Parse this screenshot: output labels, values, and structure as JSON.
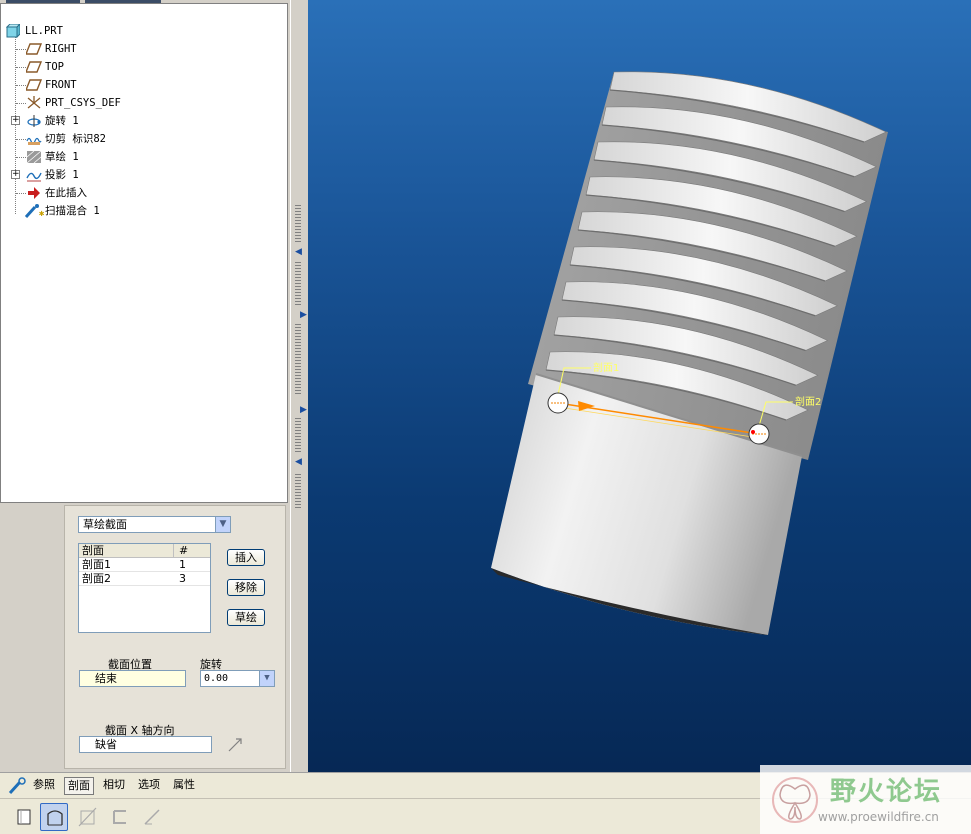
{
  "model_tree": {
    "items": [
      {
        "label": "LL.PRT",
        "icon": "part-icon"
      },
      {
        "label": "RIGHT",
        "icon": "datum-plane-icon"
      },
      {
        "label": "TOP",
        "icon": "datum-plane-icon"
      },
      {
        "label": "FRONT",
        "icon": "datum-plane-icon"
      },
      {
        "label": "PRT_CSYS_DEF",
        "icon": "coordinate-system-icon"
      },
      {
        "label": "旋转 1",
        "icon": "revolve-icon"
      },
      {
        "label": "切剪 标识82",
        "icon": "cut-icon"
      },
      {
        "label": "草绘 1",
        "icon": "sketch-icon"
      },
      {
        "label": "投影 1",
        "icon": "projection-icon"
      },
      {
        "label": "在此插入",
        "icon": "insert-here-arrow-icon"
      },
      {
        "label": "扫描混合 1",
        "icon": "swept-blend-icon"
      }
    ]
  },
  "section_panel": {
    "section_type": "草绘截面",
    "table": {
      "headers": [
        "剖面",
        "#"
      ],
      "rows": [
        [
          "剖面1",
          "1"
        ],
        [
          "剖面2",
          "3"
        ]
      ]
    },
    "buttons": {
      "insert": "插入",
      "remove": "移除",
      "sketch": "草绘"
    },
    "location_label": "截面位置",
    "location_value": "结束",
    "rotation_label": "旋转",
    "rotation_value": "0.00",
    "x_axis_label": "截面 X 轴方向",
    "x_axis_value": "缺省"
  },
  "bottom_tabs": [
    "参照",
    "剖面",
    "相切",
    "选项",
    "属性"
  ],
  "active_tab": "剖面",
  "bottom_tools": [
    "solid-icon",
    "surface-icon",
    "remove-material-icon",
    "thicken-icon",
    "edit-icon"
  ],
  "viewport": {
    "section_labels": [
      "剖面1",
      "剖面2"
    ],
    "colors": {
      "background_top": "#2a70b8",
      "background_bottom": "#062855",
      "trajectory": "#ff8a00",
      "label": "#ffff66"
    }
  },
  "watermark": {
    "title": "野火论坛",
    "url": "www.proewildfire.cn"
  }
}
